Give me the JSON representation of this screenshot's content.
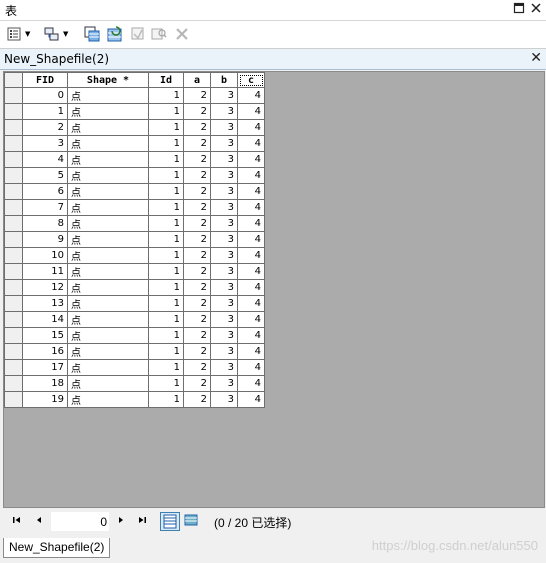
{
  "window": {
    "title": "表"
  },
  "table_tab": {
    "name": "New_Shapefile(2)"
  },
  "columns": [
    "FID",
    "Shape *",
    "Id",
    "a",
    "b",
    "c"
  ],
  "rows": [
    {
      "fid": "0",
      "shape": "点",
      "id": "1",
      "a": "2",
      "b": "3",
      "c": "4"
    },
    {
      "fid": "1",
      "shape": "点",
      "id": "1",
      "a": "2",
      "b": "3",
      "c": "4"
    },
    {
      "fid": "2",
      "shape": "点",
      "id": "1",
      "a": "2",
      "b": "3",
      "c": "4"
    },
    {
      "fid": "3",
      "shape": "点",
      "id": "1",
      "a": "2",
      "b": "3",
      "c": "4"
    },
    {
      "fid": "4",
      "shape": "点",
      "id": "1",
      "a": "2",
      "b": "3",
      "c": "4"
    },
    {
      "fid": "5",
      "shape": "点",
      "id": "1",
      "a": "2",
      "b": "3",
      "c": "4"
    },
    {
      "fid": "6",
      "shape": "点",
      "id": "1",
      "a": "2",
      "b": "3",
      "c": "4"
    },
    {
      "fid": "7",
      "shape": "点",
      "id": "1",
      "a": "2",
      "b": "3",
      "c": "4"
    },
    {
      "fid": "8",
      "shape": "点",
      "id": "1",
      "a": "2",
      "b": "3",
      "c": "4"
    },
    {
      "fid": "9",
      "shape": "点",
      "id": "1",
      "a": "2",
      "b": "3",
      "c": "4"
    },
    {
      "fid": "10",
      "shape": "点",
      "id": "1",
      "a": "2",
      "b": "3",
      "c": "4"
    },
    {
      "fid": "11",
      "shape": "点",
      "id": "1",
      "a": "2",
      "b": "3",
      "c": "4"
    },
    {
      "fid": "12",
      "shape": "点",
      "id": "1",
      "a": "2",
      "b": "3",
      "c": "4"
    },
    {
      "fid": "13",
      "shape": "点",
      "id": "1",
      "a": "2",
      "b": "3",
      "c": "4"
    },
    {
      "fid": "14",
      "shape": "点",
      "id": "1",
      "a": "2",
      "b": "3",
      "c": "4"
    },
    {
      "fid": "15",
      "shape": "点",
      "id": "1",
      "a": "2",
      "b": "3",
      "c": "4"
    },
    {
      "fid": "16",
      "shape": "点",
      "id": "1",
      "a": "2",
      "b": "3",
      "c": "4"
    },
    {
      "fid": "17",
      "shape": "点",
      "id": "1",
      "a": "2",
      "b": "3",
      "c": "4"
    },
    {
      "fid": "18",
      "shape": "点",
      "id": "1",
      "a": "2",
      "b": "3",
      "c": "4"
    },
    {
      "fid": "19",
      "shape": "点",
      "id": "1",
      "a": "2",
      "b": "3",
      "c": "4"
    }
  ],
  "navigation": {
    "current_record": "0",
    "status": "(0 / 20 已选择)"
  },
  "bottom_tab": {
    "label": "New_Shapefile(2)"
  },
  "watermark": "https://blog.csdn.net/alun550",
  "icons": {
    "close": "close-icon",
    "restore": "restore-icon",
    "table-options": "table-options-icon",
    "related-tables": "related-tables-icon",
    "select-by-attributes": "select-by-attributes-icon",
    "switch-selection": "switch-selection-icon",
    "clear-selection": "clear-selection-icon",
    "zoom-to-selected": "zoom-to-selected-icon",
    "delete-selected": "delete-selected-icon"
  },
  "colors": {
    "tab_header": "#eaf2fa",
    "grid_bg": "#ababab",
    "accent": "#1f5fa8"
  }
}
